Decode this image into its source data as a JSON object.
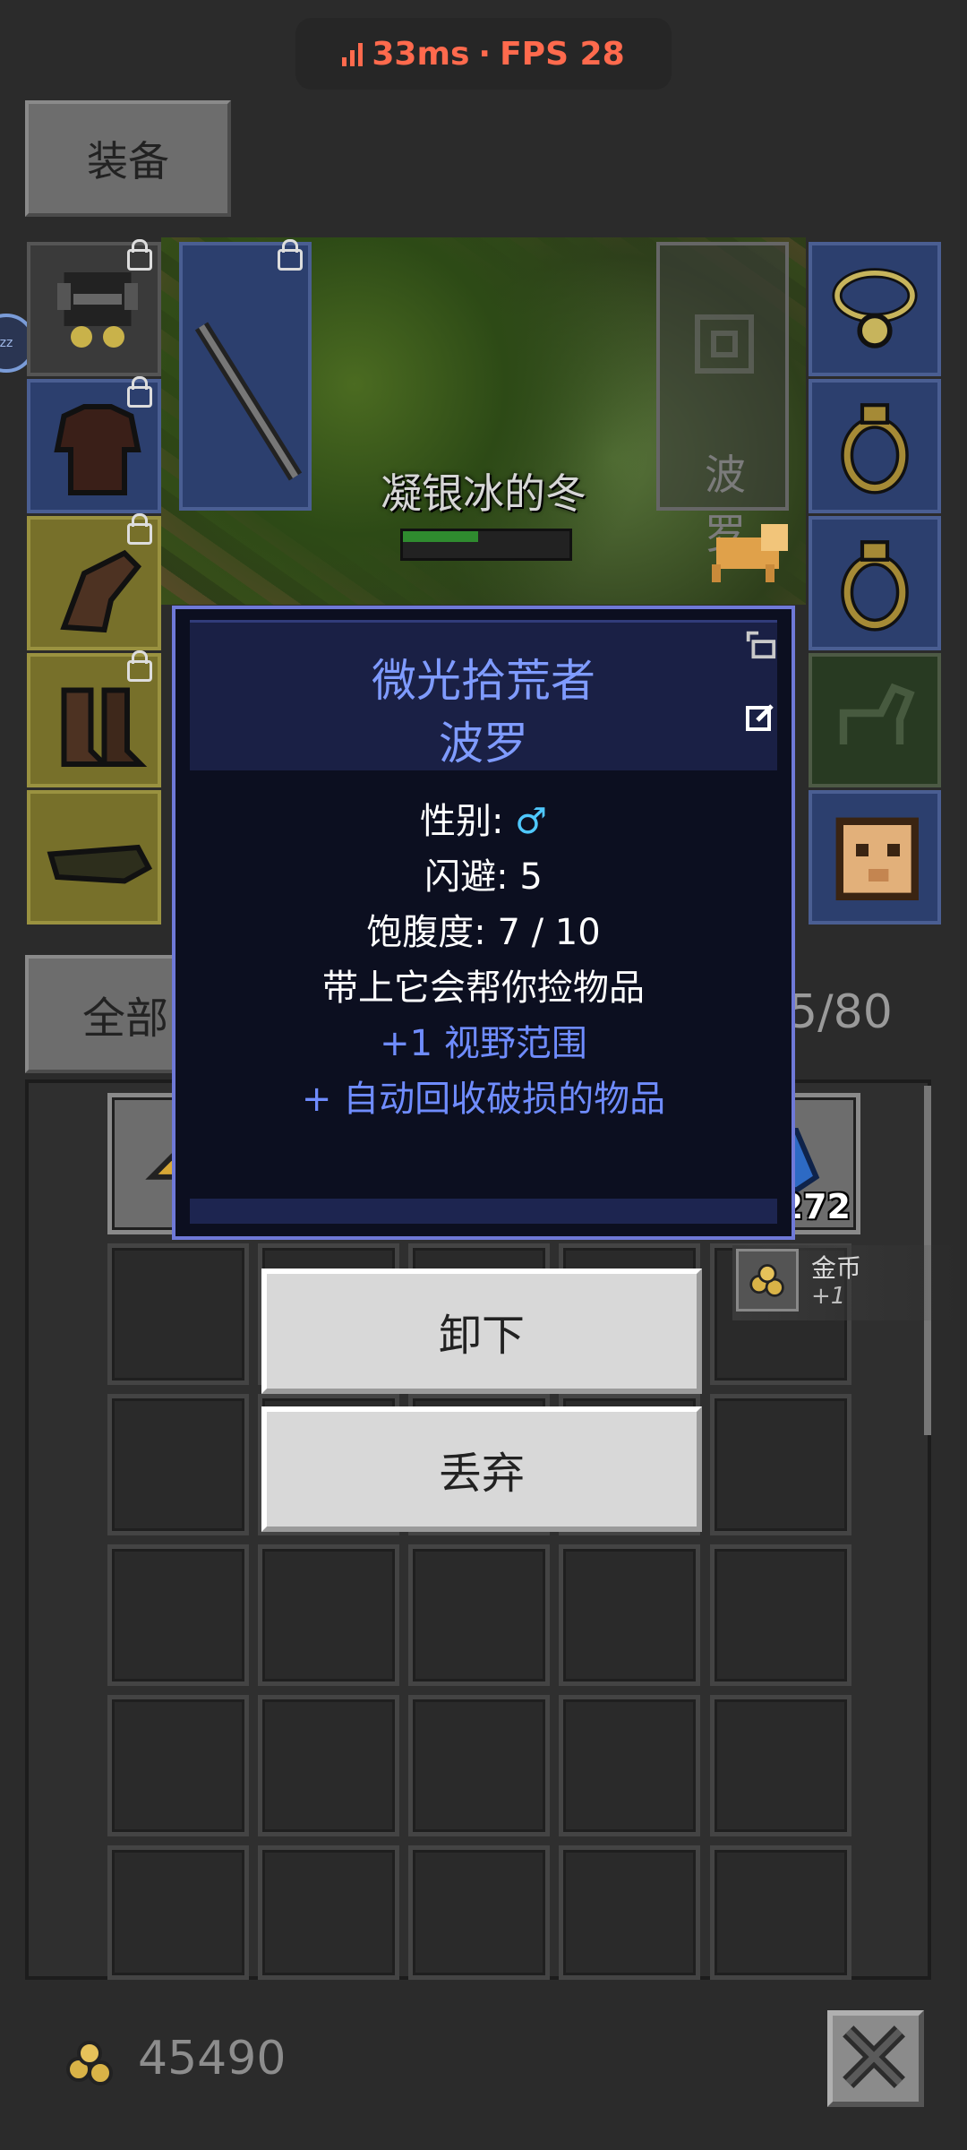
{
  "status": {
    "latency": "33ms",
    "separator": "·",
    "fps": "FPS 28",
    "color": "#ff6a4d"
  },
  "equipment": {
    "tab_label": "装备",
    "hero_name": "凝银冰的冬",
    "hp_fraction": 0.45,
    "pet_slot_label": "波罗",
    "slots": [
      {
        "name": "helmet",
        "icon": "helmet-icon",
        "locked": true
      },
      {
        "name": "weapon",
        "icon": "spear-icon",
        "locked": true
      },
      {
        "name": "armor",
        "icon": "armor-icon",
        "locked": true
      },
      {
        "name": "gloves",
        "icon": "glove-icon",
        "locked": true
      },
      {
        "name": "boots",
        "icon": "boots-icon",
        "locked": true
      },
      {
        "name": "belt",
        "icon": "belt-icon",
        "locked": false
      },
      {
        "name": "amulet",
        "icon": "amulet-icon",
        "locked": false
      },
      {
        "name": "ring-1",
        "icon": "ring-icon",
        "locked": false
      },
      {
        "name": "ring-2",
        "icon": "ring-icon",
        "locked": false
      },
      {
        "name": "mount",
        "icon": "horse-icon",
        "locked": false
      },
      {
        "name": "pet",
        "icon": "dog-pet-icon",
        "locked": false
      }
    ]
  },
  "filter": {
    "tab_label": "全部",
    "bag_count": "5/80"
  },
  "backpack": {
    "gold_slot_icon": "gold-pile-icon",
    "potion_qty": "272"
  },
  "toast": {
    "item_name": "金币",
    "amount": "+1"
  },
  "dialog": {
    "title_line1": "微光拾荒者",
    "title_line2": "波罗",
    "gender_label": "性别: ",
    "gender_symbol": "♂",
    "dodge": "闪避: 5",
    "satiety": "饱腹度: 7 / 10",
    "description": "带上它会帮你捡物品",
    "bonus1": "+1 视野范围",
    "bonus2": "+ 自动回收破损的物品",
    "title_color": "#7f9bff"
  },
  "actions": {
    "unequip": "卸下",
    "drop": "丢弃"
  },
  "bottom": {
    "gold_amount": "45490"
  }
}
